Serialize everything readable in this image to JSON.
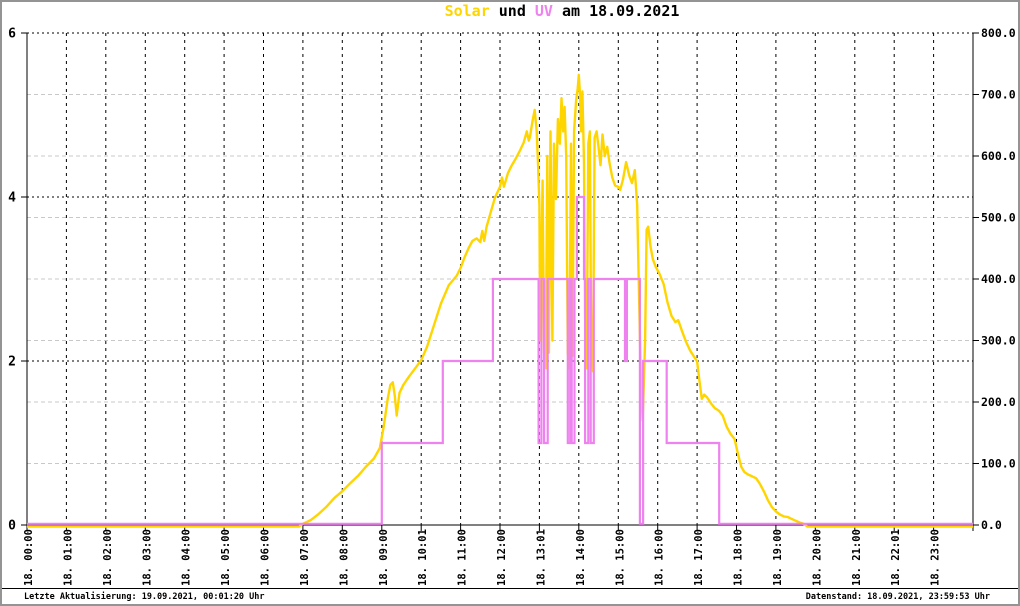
{
  "title": {
    "parts": [
      {
        "text": "Solar",
        "color": "#FFD500"
      },
      {
        "text": " und ",
        "color": "#000000"
      },
      {
        "text": "UV",
        "color": "#EE82EE"
      },
      {
        "text": " am 18.09.2021",
        "color": "#000000"
      }
    ]
  },
  "footer": {
    "left": "Letzte Aktualisierung: 19.09.2021, 00:01:20 Uhr",
    "right": "Datenstand: 18.09.2021, 23:59:53 Uhr"
  },
  "chart_data": {
    "type": "line",
    "title": "Solar und UV am 18.09.2021",
    "legend_position": "none",
    "grid": {
      "gray_right_values": [
        100,
        200,
        300,
        400,
        500,
        600,
        700
      ],
      "black_right_values": [
        266.67,
        533.33,
        800
      ]
    },
    "colors": {
      "solar": "#FFD500",
      "uv": "#EE82EE",
      "grid_minor": "#C8C8C8",
      "grid_major": "#000000",
      "axis": "#000000",
      "background": "#FFFFFF",
      "border": "#949494"
    },
    "x_axis": {
      "hours": [
        0,
        1,
        2,
        3,
        4,
        5,
        6,
        7,
        8,
        9,
        10,
        11,
        12,
        13,
        14,
        15,
        16,
        17,
        18,
        19,
        20,
        21,
        22,
        23
      ],
      "labels": [
        "18. 00:00",
        "18. 01:00",
        "18. 02:00",
        "18. 03:00",
        "18. 04:00",
        "18. 05:00",
        "18. 06:00",
        "18. 07:00",
        "18. 08:00",
        "18. 09:00",
        "18. 10:01",
        "18. 11:00",
        "18. 12:00",
        "18. 13:01",
        "18. 14:00",
        "18. 15:00",
        "18. 16:00",
        "18. 17:00",
        "18. 18:00",
        "18. 19:00",
        "18. 20:00",
        "18. 21:00",
        "18. 22:01",
        "18. 23:00"
      ],
      "range_hours": [
        0,
        24
      ]
    },
    "y_left": {
      "labels": [
        "0",
        "2",
        "4",
        "6"
      ],
      "values": [
        0,
        2,
        4,
        6
      ],
      "max": 6,
      "series": "UV"
    },
    "y_right": {
      "labels": [
        "0.0",
        "100.0",
        "200.0",
        "300.0",
        "400.0",
        "500.0",
        "600.0",
        "700.0",
        "800.0"
      ],
      "values": [
        0,
        100,
        200,
        300,
        400,
        500,
        600,
        700,
        800
      ],
      "max": 800,
      "series": "Solar"
    },
    "series": [
      {
        "name": "Solar",
        "axis": "right",
        "style": "jagged-line",
        "points": [
          [
            0,
            0
          ],
          [
            1,
            0
          ],
          [
            2,
            0
          ],
          [
            3,
            0
          ],
          [
            4,
            0
          ],
          [
            5,
            0
          ],
          [
            6,
            0
          ],
          [
            6.9,
            0
          ],
          [
            7.0,
            2
          ],
          [
            7.2,
            8
          ],
          [
            7.4,
            18
          ],
          [
            7.6,
            30
          ],
          [
            7.8,
            44
          ],
          [
            8.0,
            55
          ],
          [
            8.2,
            68
          ],
          [
            8.4,
            80
          ],
          [
            8.6,
            95
          ],
          [
            8.8,
            108
          ],
          [
            8.95,
            125
          ],
          [
            9.05,
            160
          ],
          [
            9.15,
            205
          ],
          [
            9.22,
            228
          ],
          [
            9.28,
            232
          ],
          [
            9.33,
            210
          ],
          [
            9.38,
            178
          ],
          [
            9.45,
            215
          ],
          [
            9.55,
            228
          ],
          [
            9.7,
            242
          ],
          [
            9.85,
            255
          ],
          [
            10.0,
            268
          ],
          [
            10.15,
            290
          ],
          [
            10.3,
            320
          ],
          [
            10.5,
            360
          ],
          [
            10.7,
            390
          ],
          [
            10.9,
            405
          ],
          [
            11.0,
            418
          ],
          [
            11.1,
            435
          ],
          [
            11.2,
            450
          ],
          [
            11.3,
            462
          ],
          [
            11.41,
            466
          ],
          [
            11.5,
            460
          ],
          [
            11.55,
            478
          ],
          [
            11.6,
            462
          ],
          [
            11.66,
            485
          ],
          [
            11.75,
            505
          ],
          [
            11.87,
            532
          ],
          [
            12.0,
            550
          ],
          [
            12.05,
            565
          ],
          [
            12.1,
            550
          ],
          [
            12.2,
            572
          ],
          [
            12.3,
            585
          ],
          [
            12.4,
            596
          ],
          [
            12.5,
            608
          ],
          [
            12.6,
            622
          ],
          [
            12.68,
            640
          ],
          [
            12.73,
            625
          ],
          [
            12.76,
            631
          ],
          [
            12.82,
            655
          ],
          [
            12.88,
            675
          ],
          [
            12.93,
            640
          ],
          [
            12.97,
            580
          ],
          [
            13.0,
            520
          ],
          [
            13.02,
            300
          ],
          [
            13.05,
            430
          ],
          [
            13.08,
            560
          ],
          [
            13.12,
            280
          ],
          [
            13.16,
            255
          ],
          [
            13.2,
            600
          ],
          [
            13.24,
            280
          ],
          [
            13.28,
            640
          ],
          [
            13.33,
            300
          ],
          [
            13.37,
            620
          ],
          [
            13.42,
            530
          ],
          [
            13.47,
            660
          ],
          [
            13.52,
            620
          ],
          [
            13.56,
            694
          ],
          [
            13.6,
            640
          ],
          [
            13.64,
            680
          ],
          [
            13.68,
            600
          ],
          [
            13.72,
            280
          ],
          [
            13.76,
            255
          ],
          [
            13.8,
            620
          ],
          [
            13.84,
            275
          ],
          [
            13.88,
            640
          ],
          [
            13.93,
            690
          ],
          [
            13.97,
            710
          ],
          [
            14.0,
            732
          ],
          [
            14.03,
            700
          ],
          [
            14.06,
            640
          ],
          [
            14.09,
            705
          ],
          [
            14.13,
            590
          ],
          [
            14.16,
            340
          ],
          [
            14.2,
            255
          ],
          [
            14.24,
            620
          ],
          [
            14.28,
            640
          ],
          [
            14.31,
            300
          ],
          [
            14.36,
            250
          ],
          [
            14.4,
            630
          ],
          [
            14.45,
            640
          ],
          [
            14.5,
            615
          ],
          [
            14.55,
            585
          ],
          [
            14.6,
            635
          ],
          [
            14.66,
            600
          ],
          [
            14.72,
            615
          ],
          [
            14.78,
            588
          ],
          [
            14.85,
            565
          ],
          [
            14.92,
            552
          ],
          [
            15.0,
            550
          ],
          [
            15.05,
            545
          ],
          [
            15.12,
            562
          ],
          [
            15.2,
            590
          ],
          [
            15.28,
            568
          ],
          [
            15.35,
            556
          ],
          [
            15.42,
            577
          ],
          [
            15.48,
            520
          ],
          [
            15.52,
            400
          ],
          [
            15.58,
            220
          ],
          [
            15.62,
            170
          ],
          [
            15.68,
            300
          ],
          [
            15.72,
            480
          ],
          [
            15.76,
            485
          ],
          [
            15.82,
            452
          ],
          [
            15.88,
            432
          ],
          [
            15.95,
            420
          ],
          [
            16.05,
            408
          ],
          [
            16.15,
            392
          ],
          [
            16.25,
            362
          ],
          [
            16.35,
            340
          ],
          [
            16.45,
            330
          ],
          [
            16.52,
            333
          ],
          [
            16.62,
            315
          ],
          [
            16.72,
            298
          ],
          [
            16.82,
            284
          ],
          [
            16.92,
            274
          ],
          [
            17.0,
            266
          ],
          [
            17.06,
            235
          ],
          [
            17.12,
            205
          ],
          [
            17.18,
            212
          ],
          [
            17.25,
            208
          ],
          [
            17.35,
            198
          ],
          [
            17.45,
            190
          ],
          [
            17.55,
            186
          ],
          [
            17.65,
            178
          ],
          [
            17.75,
            160
          ],
          [
            17.85,
            148
          ],
          [
            17.95,
            140
          ],
          [
            18.05,
            112
          ],
          [
            18.12,
            95
          ],
          [
            18.2,
            86
          ],
          [
            18.3,
            82
          ],
          [
            18.4,
            79
          ],
          [
            18.5,
            76
          ],
          [
            18.6,
            66
          ],
          [
            18.7,
            54
          ],
          [
            18.8,
            40
          ],
          [
            18.9,
            29
          ],
          [
            19.0,
            22
          ],
          [
            19.1,
            17
          ],
          [
            19.2,
            14
          ],
          [
            19.3,
            13
          ],
          [
            19.4,
            10
          ],
          [
            19.5,
            7
          ],
          [
            19.6,
            4
          ],
          [
            19.7,
            2
          ],
          [
            19.8,
            0
          ],
          [
            20.0,
            0
          ],
          [
            21.0,
            0
          ],
          [
            22.0,
            0
          ],
          [
            23.0,
            0
          ],
          [
            24.0,
            0
          ]
        ]
      },
      {
        "name": "UV",
        "axis": "left",
        "style": "step",
        "points": [
          [
            0,
            0
          ],
          [
            9.0,
            1
          ],
          [
            10.55,
            2
          ],
          [
            11.82,
            3
          ],
          [
            12.98,
            1
          ],
          [
            13.05,
            3
          ],
          [
            13.12,
            1
          ],
          [
            13.21,
            3
          ],
          [
            13.72,
            1
          ],
          [
            13.78,
            3
          ],
          [
            13.82,
            1
          ],
          [
            13.89,
            3
          ],
          [
            13.95,
            4
          ],
          [
            14.13,
            3
          ],
          [
            14.16,
            1
          ],
          [
            14.24,
            3
          ],
          [
            14.3,
            1
          ],
          [
            14.38,
            3
          ],
          [
            15.17,
            2
          ],
          [
            15.22,
            3
          ],
          [
            15.55,
            0
          ],
          [
            15.63,
            2
          ],
          [
            16.23,
            1
          ],
          [
            17.56,
            0
          ],
          [
            24,
            0
          ]
        ]
      }
    ]
  }
}
